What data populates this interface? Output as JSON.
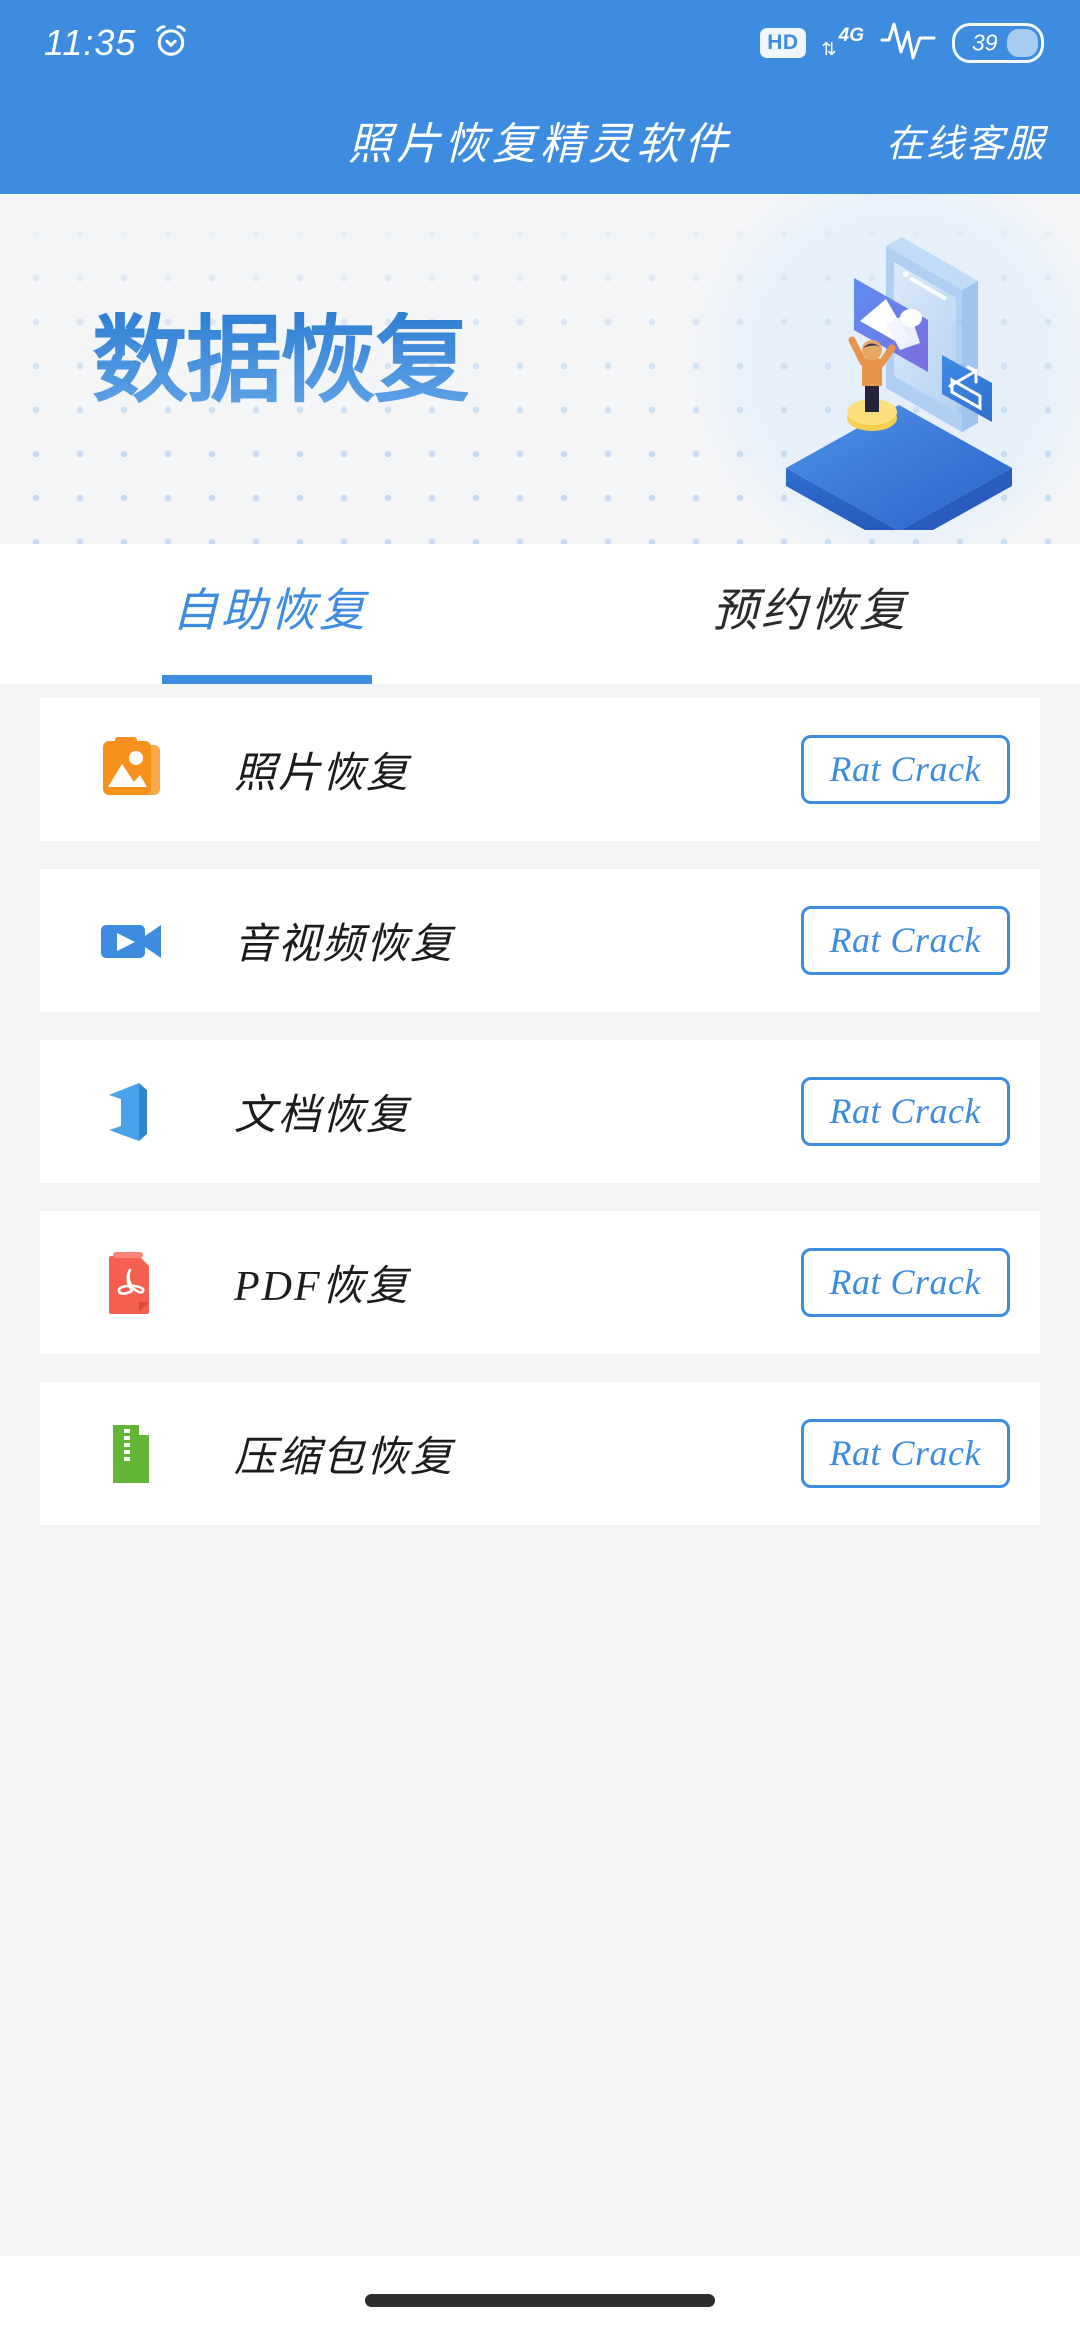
{
  "statusbar": {
    "time": "11:35",
    "alarm_icon": "alarm-clock-icon",
    "hd_label": "HD",
    "network_label": "4G",
    "network_arrows": "⇅",
    "signal_icon": "signal-waveform-icon",
    "battery_percent": "39",
    "battery_level": 39
  },
  "header": {
    "title": "照片恢复精灵软件",
    "action_label": "在线客服",
    "bg_color": "#3d8ce0"
  },
  "banner": {
    "title": "数据恢复",
    "illustration": "isometric-data-recovery-illustration",
    "accent_color": "#2f7fd4",
    "bg_color": "#f4f5f6"
  },
  "tabs": {
    "items": [
      {
        "label": "自助恢复",
        "active": true
      },
      {
        "label": "预约恢复",
        "active": false
      }
    ],
    "active_color": "#3d8ce0",
    "inactive_color": "#2b2b2b"
  },
  "list": {
    "rows": [
      {
        "label": "照片恢复",
        "icon": "photo-stack-icon",
        "icon_color": "#f7911e",
        "button": "Rat Crack"
      },
      {
        "label": "音视频恢复",
        "icon": "video-camera-icon",
        "icon_color": "#3d8ce0",
        "button": "Rat Crack"
      },
      {
        "label": "文档恢复",
        "icon": "office-doc-icon",
        "icon_color": "#49a2ea",
        "button": "Rat Crack"
      },
      {
        "label": "PDF恢复",
        "icon": "pdf-file-icon",
        "icon_color": "#f4604f",
        "button": "Rat Crack"
      },
      {
        "label": "压缩包恢复",
        "icon": "zip-archive-icon",
        "icon_color": "#63b635",
        "button": "Rat Crack"
      }
    ],
    "button_border_color": "#3d8ce0"
  },
  "navbar": {
    "home_indicator": "home-gesture-bar"
  }
}
